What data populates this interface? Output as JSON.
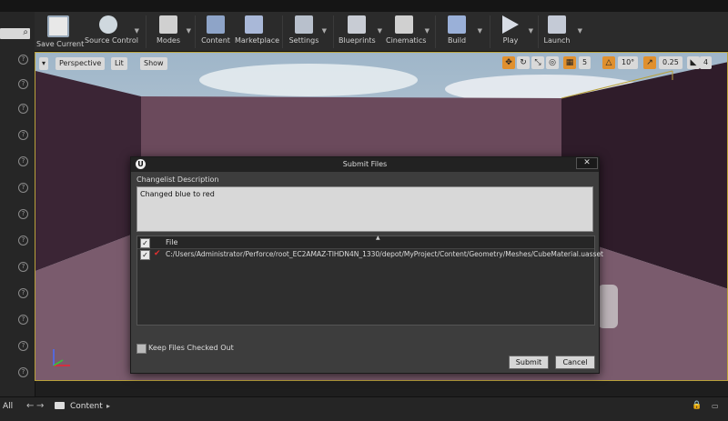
{
  "toolbar": {
    "buttons": [
      {
        "label": "Save Current",
        "icon": "save-icon"
      },
      {
        "label": "Source Control",
        "icon": "source-control-icon"
      },
      {
        "label": "Modes",
        "icon": "modes-icon"
      },
      {
        "label": "Content",
        "icon": "content-icon"
      },
      {
        "label": "Marketplace",
        "icon": "marketplace-icon"
      },
      {
        "label": "Settings",
        "icon": "settings-icon"
      },
      {
        "label": "Blueprints",
        "icon": "blueprints-icon"
      },
      {
        "label": "Cinematics",
        "icon": "cinematics-icon"
      },
      {
        "label": "Build",
        "icon": "build-icon"
      },
      {
        "label": "Play",
        "icon": "play-icon"
      },
      {
        "label": "Launch",
        "icon": "launch-icon"
      }
    ]
  },
  "viewport": {
    "view_mode": "Perspective",
    "lighting": "Lit",
    "show": "Show",
    "grid_snap": "5",
    "rotation_snap": "10°",
    "scale_snap": "0.25",
    "camera_speed": "4"
  },
  "dialog": {
    "title": "Submit Files",
    "description_label": "Changelist Description",
    "description_text": "Changed blue to red",
    "file_column_header": "File",
    "file_path": "C:/Users/Administrator/Perforce/root_EC2AMAZ-TIHDN4N_1330/depot/MyProject/Content/Geometry/Meshes/CubeMaterial.uasset",
    "keep_checked_out_label": "Keep Files Checked Out",
    "submit_label": "Submit",
    "cancel_label": "Cancel"
  },
  "content_browser": {
    "filter_label": "All",
    "path_label": "Content"
  },
  "colors": {
    "toolbar_bg": "#2b2b2b",
    "dialog_bg": "#3d3d3d",
    "viewport_border": "#b9a13a",
    "wall": "#6b4a5c",
    "accent_orange": "#e0902e"
  }
}
